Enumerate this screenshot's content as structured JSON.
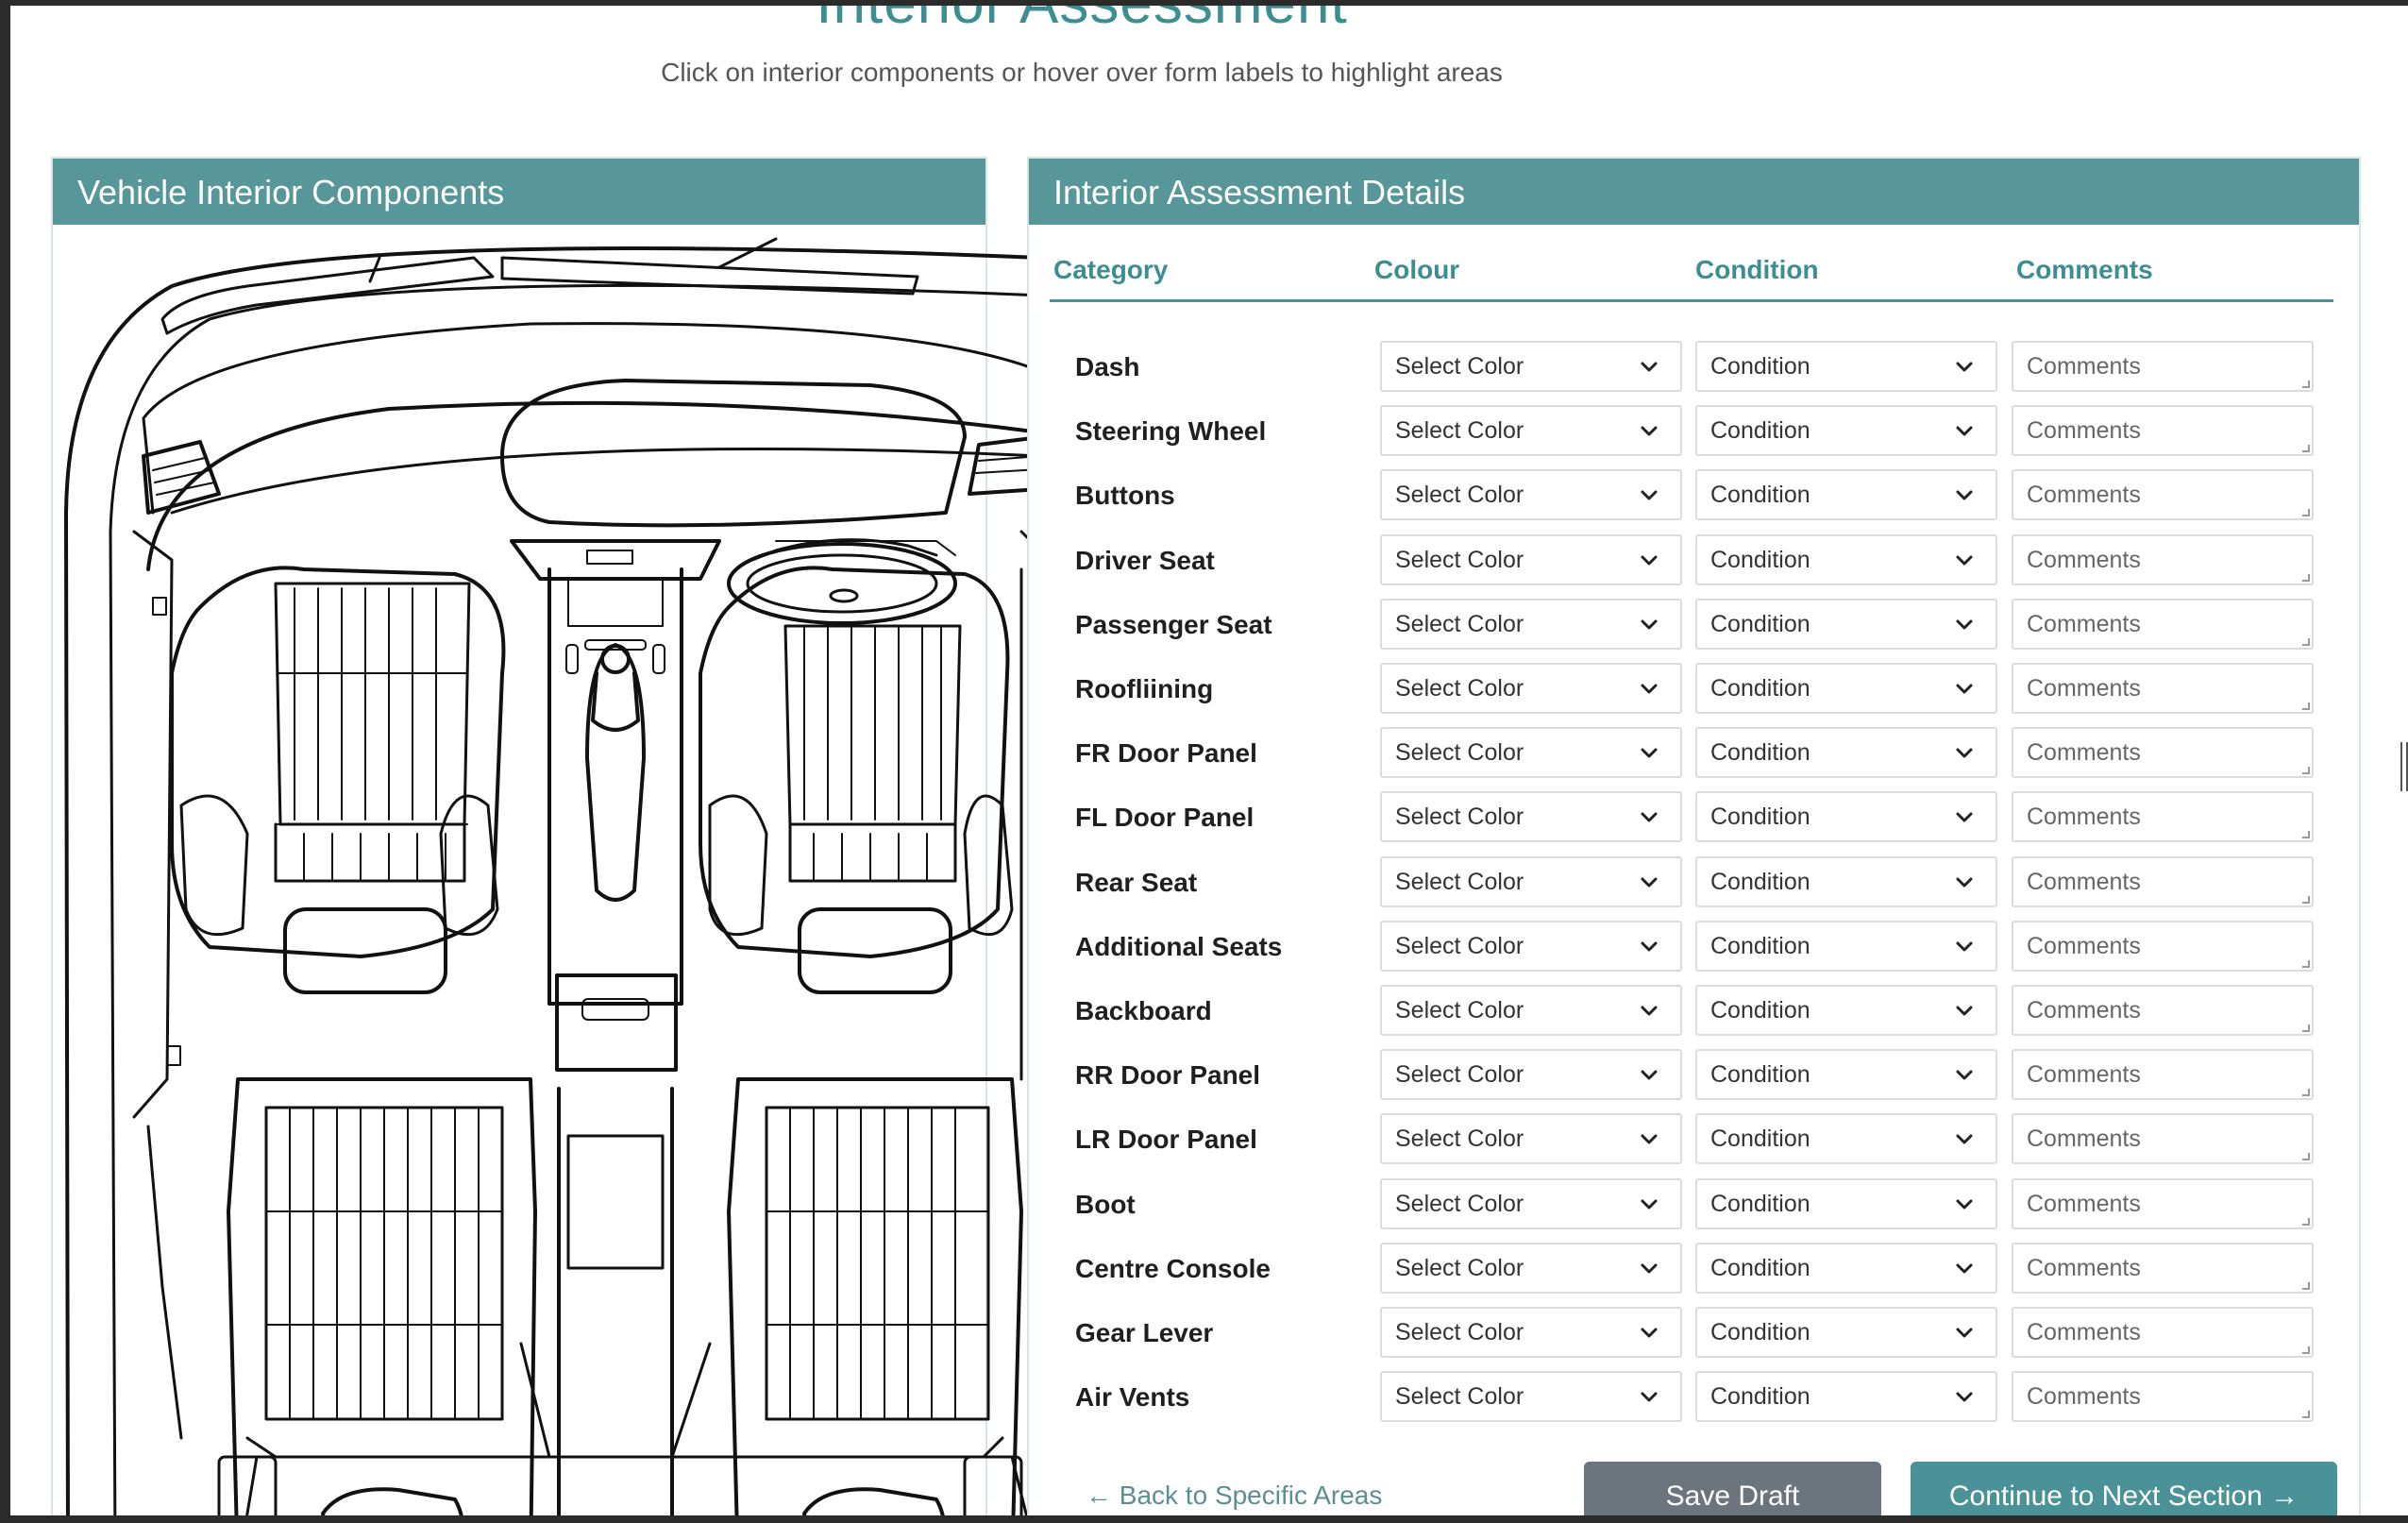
{
  "header": {
    "title": "Interior Assessment",
    "subtitle": "Click on interior components or hover over form labels to highlight areas"
  },
  "left_panel": {
    "title": "Vehicle Interior Components"
  },
  "right_panel": {
    "title": "Interior Assessment Details",
    "columns": [
      "Category",
      "Colour",
      "Condition",
      "Comments"
    ],
    "color_placeholder": "Select Color",
    "condition_placeholder": "Condition",
    "comments_placeholder": "Comments",
    "rows": [
      {
        "category": "Dash"
      },
      {
        "category": "Steering Wheel"
      },
      {
        "category": "Buttons"
      },
      {
        "category": "Driver Seat"
      },
      {
        "category": "Passenger Seat"
      },
      {
        "category": "Roofliining"
      },
      {
        "category": "FR Door Panel"
      },
      {
        "category": "FL Door Panel"
      },
      {
        "category": "Rear Seat"
      },
      {
        "category": "Additional Seats"
      },
      {
        "category": "Backboard"
      },
      {
        "category": "RR Door Panel"
      },
      {
        "category": "LR Door Panel"
      },
      {
        "category": "Boot"
      },
      {
        "category": "Centre Console"
      },
      {
        "category": "Gear Lever"
      },
      {
        "category": "Air Vents"
      }
    ]
  },
  "actions": {
    "back_label": "← Back to Specific Areas",
    "save_label": "Save Draft",
    "continue_label": "Continue to Next Section →"
  },
  "colors": {
    "accent": "#57979a",
    "title": "#3d8e93",
    "save_button": "#6c757d",
    "continue_button": "#4a9297"
  }
}
